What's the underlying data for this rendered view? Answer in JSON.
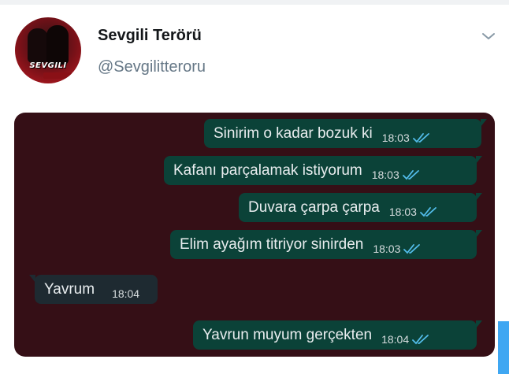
{
  "tweet": {
    "display_name": "Sevgili Terörü",
    "handle": "@Sevgilitteroru",
    "avatar_logo": "SEVGILI"
  },
  "colors": {
    "chat_background": "#350f16",
    "outgoing_bubble": "#0b4238",
    "incoming_bubble": "#1e2a31",
    "read_ticks": "#53bdeb"
  },
  "icons": {
    "menu": "chevron-down-icon",
    "read_receipt": "double-check-icon"
  },
  "chat": {
    "messages": [
      {
        "text": "Sinirim o kadar bozuk ki",
        "time": "18:03",
        "direction": "outgoing",
        "read": true
      },
      {
        "text": "Kafanı parçalamak istiyorum",
        "time": "18:03",
        "direction": "outgoing",
        "read": true
      },
      {
        "text": "Duvara çarpa çarpa",
        "time": "18:03",
        "direction": "outgoing",
        "read": true
      },
      {
        "text": "Elim ayağım titriyor sinirden",
        "time": "18:03",
        "direction": "outgoing",
        "read": true
      },
      {
        "text": "Yavrum",
        "time": "18:04",
        "direction": "incoming",
        "read": false
      },
      {
        "text": "Yavrun muyum gerçekten",
        "time": "18:04",
        "direction": "outgoing",
        "read": true
      }
    ]
  }
}
